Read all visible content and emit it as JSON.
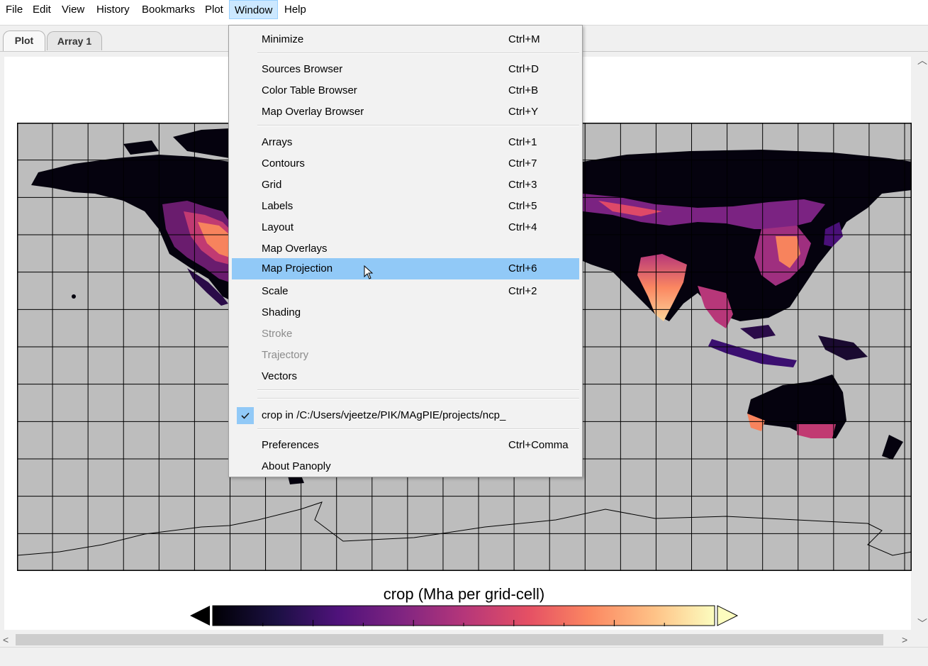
{
  "menubar": {
    "items": [
      "File",
      "Edit",
      "View",
      "History",
      "Bookmarks",
      "Plot",
      "Window",
      "Help"
    ],
    "open": "Window"
  },
  "tabs": [
    {
      "label": "Plot",
      "active": true
    },
    {
      "label": "Array 1",
      "active": false
    }
  ],
  "window_menu": {
    "items": [
      {
        "label": "Minimize",
        "shortcut": "Ctrl+M"
      },
      {
        "label": "Sources Browser",
        "shortcut": "Ctrl+D"
      },
      {
        "label": "Color Table Browser",
        "shortcut": "Ctrl+B"
      },
      {
        "label": "Map Overlay Browser",
        "shortcut": "Ctrl+Y"
      },
      {
        "label": "Arrays",
        "shortcut": "Ctrl+1"
      },
      {
        "label": "Contours",
        "shortcut": "Ctrl+7"
      },
      {
        "label": "Grid",
        "shortcut": "Ctrl+3"
      },
      {
        "label": "Labels",
        "shortcut": "Ctrl+5"
      },
      {
        "label": "Layout",
        "shortcut": "Ctrl+4"
      },
      {
        "label": "Map Overlays",
        "shortcut": ""
      },
      {
        "label": "Map Projection",
        "shortcut": "Ctrl+6",
        "highlighted": true
      },
      {
        "label": "Scale",
        "shortcut": "Ctrl+2"
      },
      {
        "label": "Shading",
        "shortcut": ""
      },
      {
        "label": "Stroke",
        "shortcut": "",
        "disabled": true
      },
      {
        "label": "Trajectory",
        "shortcut": "",
        "disabled": true
      },
      {
        "label": "Vectors",
        "shortcut": ""
      },
      {
        "label": "crop in /C:/Users/vjeetze/PIK/MAgPIE/projects/ncp_",
        "shortcut": "",
        "checked": true
      },
      {
        "label": "Preferences",
        "shortcut": "Ctrl+Comma"
      },
      {
        "label": "About Panoply",
        "shortcut": ""
      }
    ]
  },
  "plot": {
    "colorbar_title": "crop (Mha per grid-cell)",
    "colormap": "magma",
    "colors": {
      "ocean": "#bdbdbd",
      "land_low": "#000004",
      "land_mid": "#8c2981",
      "land_high": "#fcfdbf",
      "highlight": "#91c9f7"
    }
  }
}
